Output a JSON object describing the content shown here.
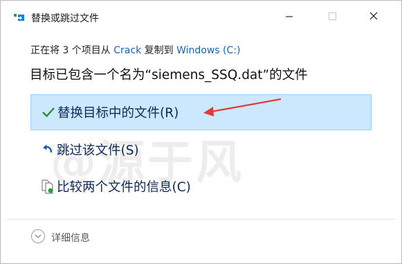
{
  "window": {
    "title": "替换或跳过文件"
  },
  "message": {
    "prefix": "正在将 3 个项目从 ",
    "source": "Crack",
    "middle": " 复制到 ",
    "destination": "Windows (C:)"
  },
  "headline": "目标已包含一个名为“siemens_SSQ.dat”的文件",
  "options": [
    {
      "label": "替换目标中的文件(R)",
      "icon": "checkmark-icon",
      "selected": true
    },
    {
      "label": "跳过该文件(S)",
      "icon": "skip-arrow-icon",
      "selected": false
    },
    {
      "label": "比较两个文件的信息(C)",
      "icon": "compare-files-icon",
      "selected": false
    }
  ],
  "details": {
    "label": "详细信息"
  },
  "watermark": "@源于风",
  "colors": {
    "selected_bg": "#cce8ff",
    "selected_border": "#99d1ff",
    "link": "#1a63b5",
    "annotation_arrow": "#e53935",
    "check_green": "#2e8b3d"
  }
}
